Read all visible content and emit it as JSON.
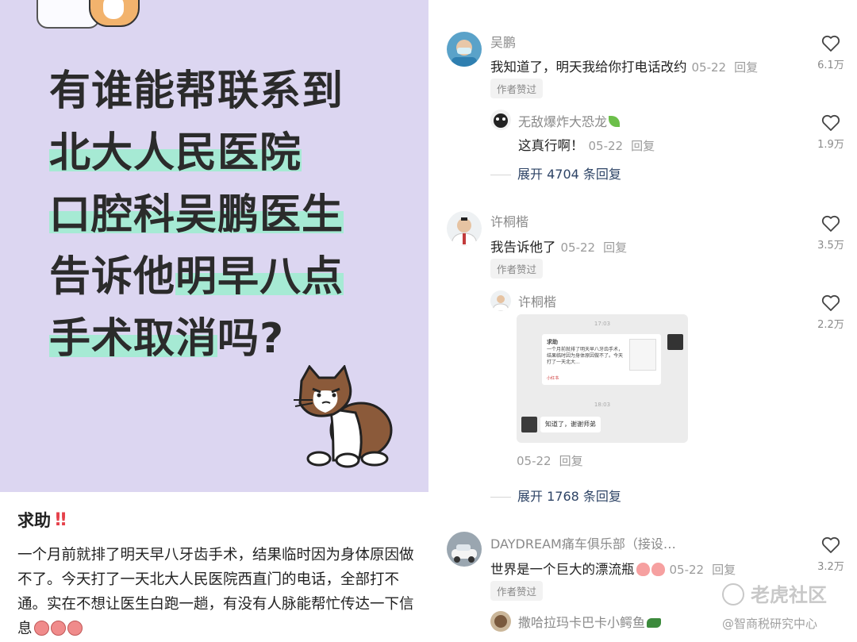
{
  "post": {
    "headline_lines": [
      {
        "plain": "有谁能帮联系到",
        "highlight": ""
      },
      {
        "plain": "",
        "highlight": "北大人民医院"
      },
      {
        "plain": "",
        "highlight": "口腔科吴鹏医生"
      },
      {
        "plain": "告诉他",
        "highlight": "明早八点"
      },
      {
        "highlight": "手术取消",
        "plain": "吗?"
      }
    ],
    "title": "求助",
    "title_emoji": "!!",
    "body": "一个月前就排了明天早八牙齿手术，结果临时因为身体原因做不了。今天打了一天北大人民医院西直门的电话，全部打不通。实在不想让医生白跑一趟，有没有人脉能帮忙传达一下信息"
  },
  "comments": {
    "c1": {
      "name": "吴鹏",
      "text": "我知道了，明天我给你打电话改约",
      "date": "05-22",
      "reply": "回复",
      "badge": "作者赞过",
      "likes": "6.1万"
    },
    "c1r": {
      "name": "无敌爆炸大恐龙",
      "text": "这真行啊！",
      "date": "05-22",
      "reply": "回复",
      "likes": "1.9万"
    },
    "c1e": {
      "text": "展开 4704 条回复"
    },
    "c2": {
      "name": "许桐楷",
      "text": "我告诉他了",
      "date": "05-22",
      "reply": "回复",
      "badge": "作者赞过",
      "likes": "3.5万"
    },
    "c2r": {
      "name": "许桐楷",
      "date": "05-22",
      "reply": "回复",
      "likes": "2.2万",
      "shot": {
        "ts1": "17:03",
        "ts2": "18:03",
        "q_title": "求助",
        "q_body": "一个月前就排了明天早八牙齿手术，结果临时因为身体原因做不了。今天打了一天北大...",
        "q_src": "小红书",
        "answer": "知道了，谢谢师弟"
      }
    },
    "c2e": {
      "text": "展开 1768 条回复"
    },
    "c3": {
      "name": "DAYDREAM痛车俱乐部（接设…",
      "text": "世界是一个巨大的漂流瓶",
      "date": "05-22",
      "reply": "回复",
      "badge": "作者赞过",
      "likes": "3.2万"
    },
    "c3r": {
      "name": "撒哈拉玛卡巴卡小鳄鱼"
    }
  },
  "watermark": {
    "logo": "老虎社区",
    "sub": "@智商税研究中心"
  },
  "colors": {
    "bg_card": "#dcd6f1",
    "highlight": "#a6ead4",
    "link": "#2e4466",
    "alert": "#e5404a"
  }
}
